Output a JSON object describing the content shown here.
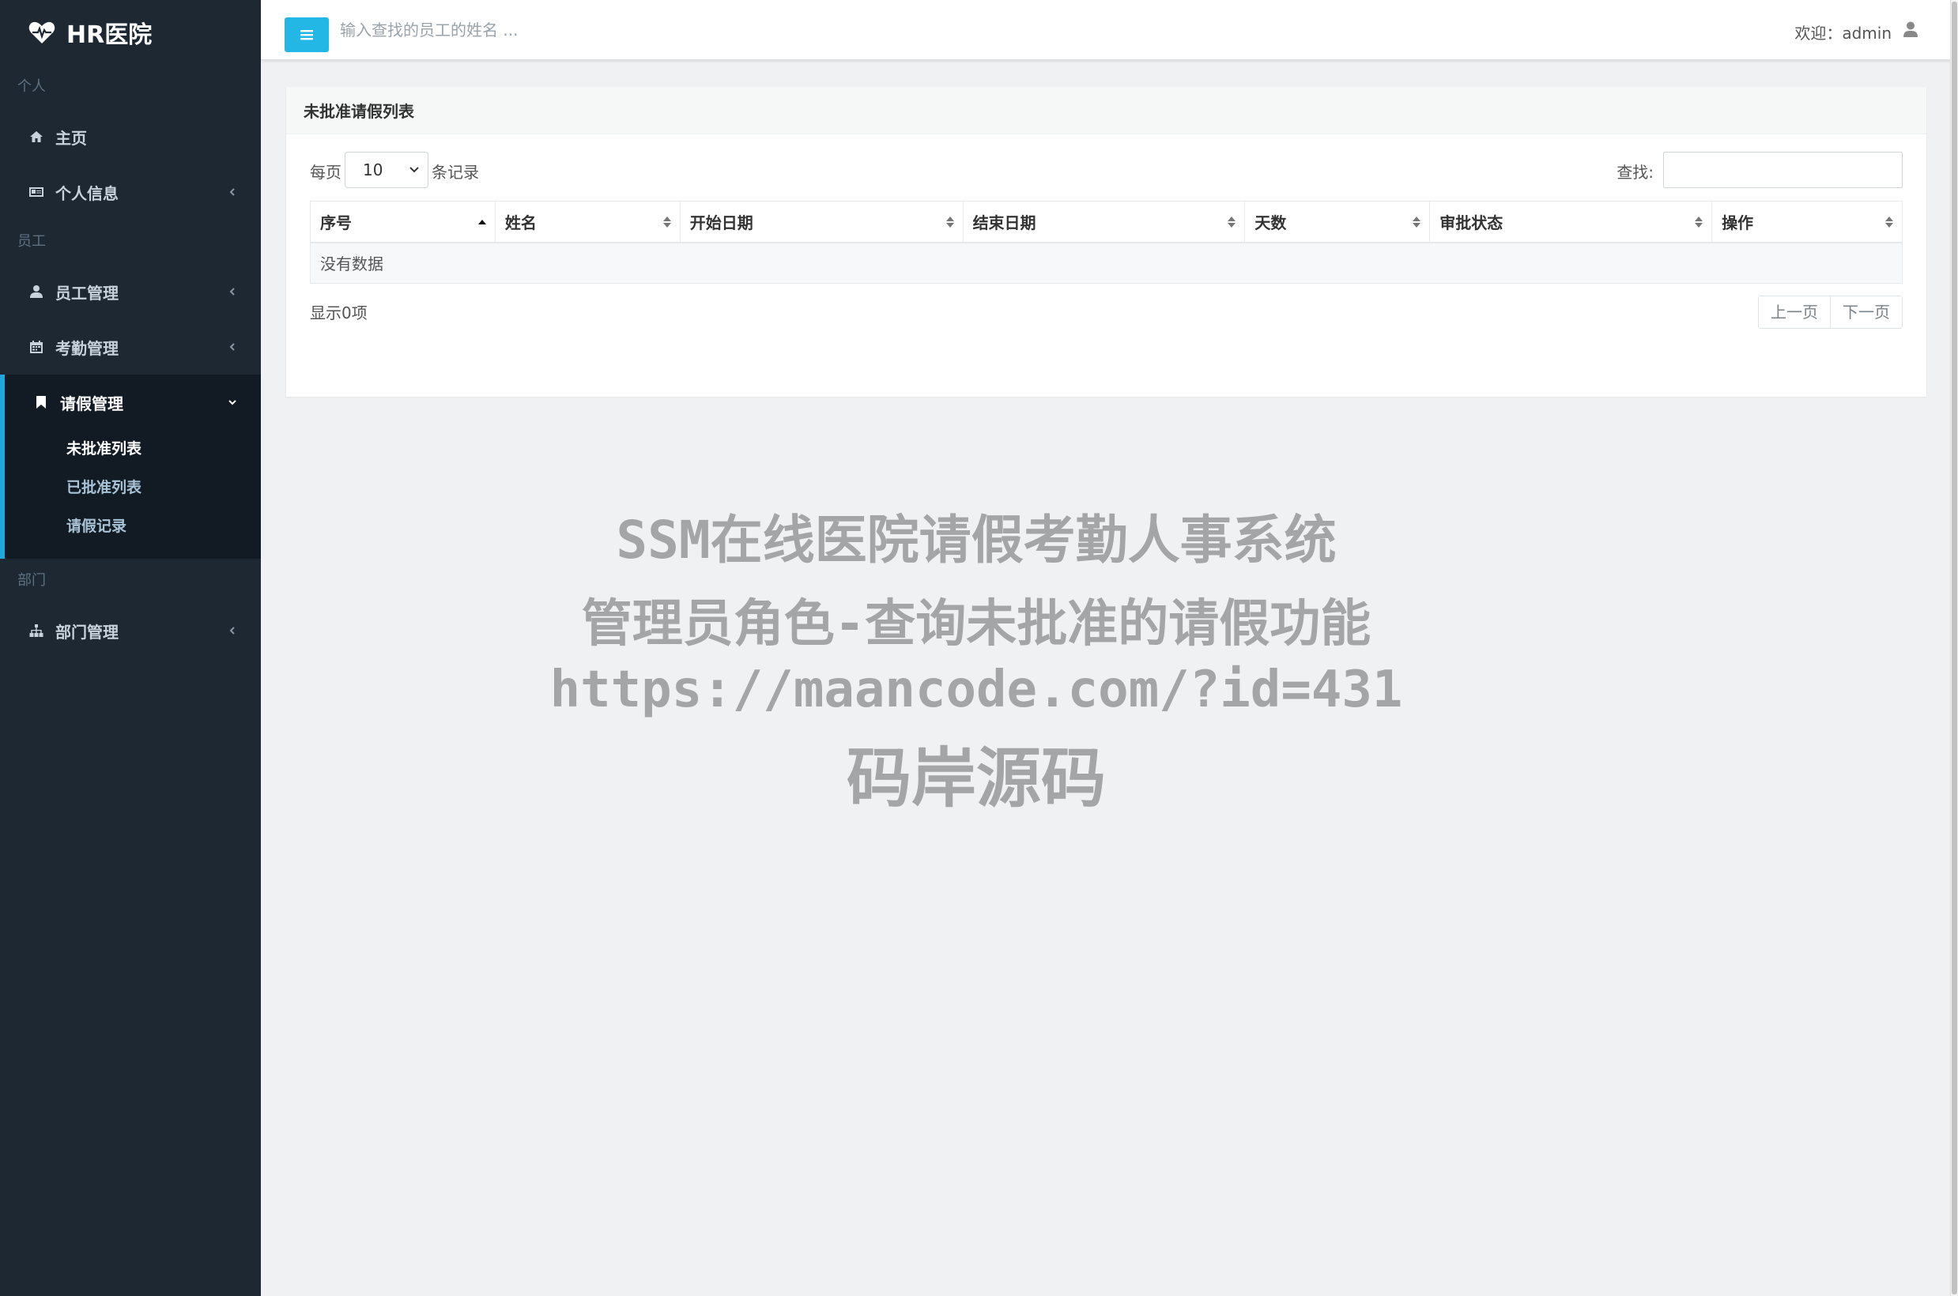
{
  "app": {
    "brand": "HR医院"
  },
  "sidebar": {
    "sections": {
      "personal": "个人",
      "staff": "员工",
      "dept": "部门"
    },
    "items": {
      "home": "主页",
      "profile": "个人信息",
      "employee_mgmt": "员工管理",
      "attendance_mgmt": "考勤管理",
      "leave_mgmt": "请假管理",
      "dept_mgmt": "部门管理"
    },
    "leave_sub": {
      "unapproved": "未批准列表",
      "approved": "已批准列表",
      "records": "请假记录"
    }
  },
  "topbar": {
    "search_placeholder": "输入查找的员工的姓名 ...",
    "welcome": "欢迎：admin"
  },
  "panel": {
    "title": "未批准请假列表",
    "length_prefix": "每页",
    "length_value": "10",
    "length_suffix": "条记录",
    "filter_label": "查找:",
    "columns": [
      "序号",
      "姓名",
      "开始日期",
      "结束日期",
      "天数",
      "审批状态",
      "操作"
    ],
    "empty_text": "没有数据",
    "info": "显示0项",
    "prev": "上一页",
    "next": "下一页"
  },
  "watermark": {
    "line1": "SSM在线医院请假考勤人事系统",
    "line2": "管理员角色-查询未批准的请假功能",
    "line3": "https://maancode.com/?id=431",
    "line4": "码岸源码"
  },
  "colors": {
    "sidebar_bg": "#1d2833",
    "accent": "#23b7e5",
    "active_group_bg": "#121b23"
  }
}
